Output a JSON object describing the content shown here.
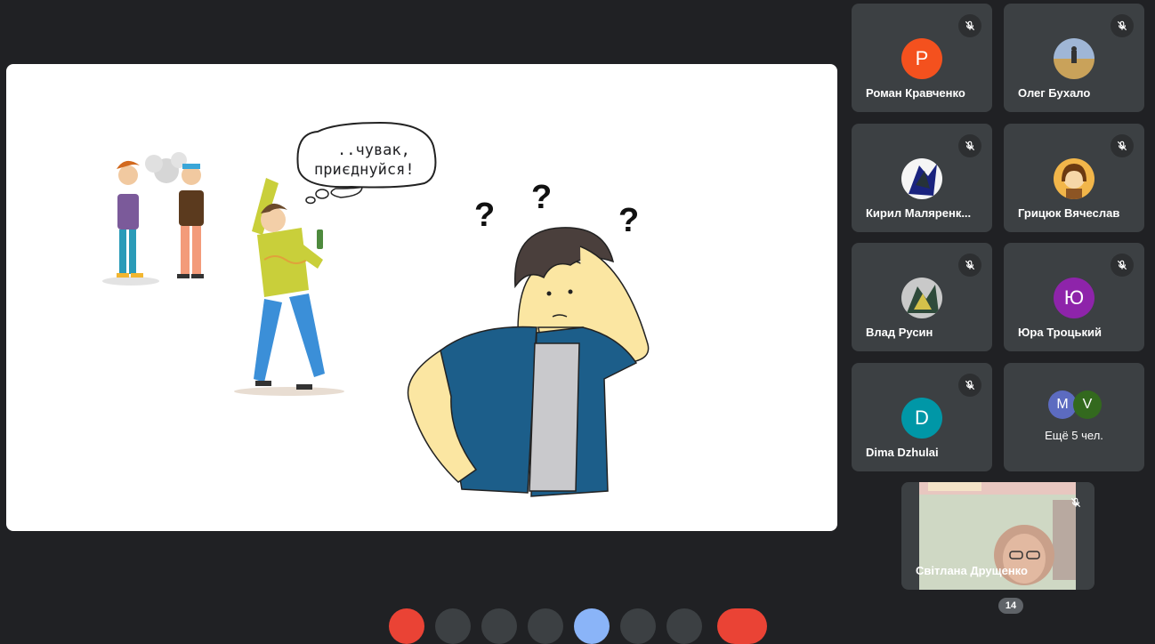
{
  "slide": {
    "speech_line1": "..чувак,",
    "speech_line2": "приєднуйся!",
    "question_mark": "?"
  },
  "participants": [
    {
      "name": "Роман Кравченко",
      "initial": "P",
      "avatar_color": "#f4511e",
      "muted": true
    },
    {
      "name": "Олег Бухало",
      "initial": "",
      "avatar_color": "#c9a25a",
      "muted": true
    },
    {
      "name": "Кирил Маляренк...",
      "initial": "",
      "avatar_color": "#1a237e",
      "muted": true
    },
    {
      "name": "Грицюк Вячеслав",
      "initial": "",
      "avatar_color": "#f2b64a",
      "muted": true
    },
    {
      "name": "Влад Русин",
      "initial": "",
      "avatar_color": "#2e4a3a",
      "muted": true
    },
    {
      "name": "Юра Троцький",
      "initial": "Ю",
      "avatar_color": "#8e24aa",
      "muted": true
    },
    {
      "name": "Dima Dzhulai",
      "initial": "D",
      "avatar_color": "#0097a7",
      "muted": true
    }
  ],
  "more": {
    "label": "Ещё 5 чел.",
    "avatars": [
      {
        "initial": "M",
        "color": "#5c6bc0"
      },
      {
        "initial": "V",
        "color": "#33691e"
      }
    ]
  },
  "self_view": {
    "name": "Світлана Друщенко",
    "muted": true
  },
  "participant_count": "14",
  "icons": {
    "mic_off": "mic-off-icon"
  }
}
